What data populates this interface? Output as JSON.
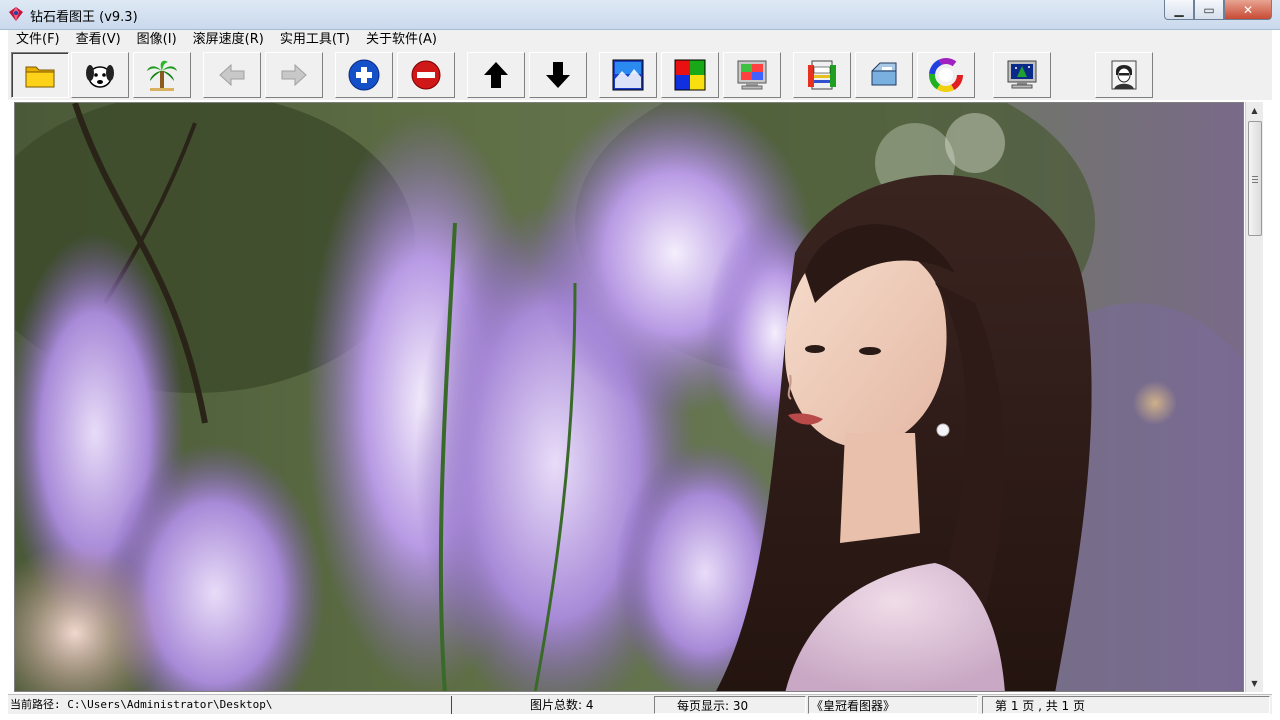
{
  "window": {
    "title": "钻石看图王 (v9.3)",
    "icon": "diamond-app-icon",
    "controls": [
      "minimize-icon",
      "maximize-icon",
      "close-icon"
    ]
  },
  "menu": {
    "items": [
      "文件(F)",
      "查看(V)",
      "图像(I)",
      "滚屏速度(R)",
      "实用工具(T)",
      "关于软件(A)"
    ]
  },
  "toolbar": {
    "buttons": [
      {
        "icon": "folder-open-icon",
        "pressed": true
      },
      {
        "icon": "dog-face-icon"
      },
      {
        "icon": "palm-tree-icon"
      },
      {
        "icon": "arrow-left-icon",
        "disabled": true
      },
      {
        "icon": "arrow-right-icon",
        "disabled": true
      },
      {
        "icon": "zoom-in-plus-icon"
      },
      {
        "icon": "zoom-out-minus-icon"
      },
      {
        "icon": "arrow-up-icon"
      },
      {
        "icon": "arrow-down-icon"
      },
      {
        "icon": "image-fx-icon"
      },
      {
        "icon": "color-grid-icon"
      },
      {
        "icon": "monitor-color-icon"
      },
      {
        "icon": "labels-icon"
      },
      {
        "icon": "scanner-icon"
      },
      {
        "icon": "color-wheel-icon"
      },
      {
        "icon": "screen-wallpaper-icon"
      },
      {
        "icon": "portrait-icon"
      }
    ]
  },
  "colors": {
    "chrome": "#f0f0f0",
    "zoom_in": "#1450c8",
    "zoom_out": "#d01818",
    "status_separator": "#2a3bd0"
  },
  "status": {
    "path_label": "当前路径:",
    "path": "C:\\Users\\Administrator\\Desktop\\",
    "total_label": "图片总数:",
    "total": "4",
    "per_page_label": "每页显示:",
    "per_page": "30",
    "viewer_name": "《皇冠看图器》",
    "page_info": "第 1 页  , 共 1 页"
  }
}
